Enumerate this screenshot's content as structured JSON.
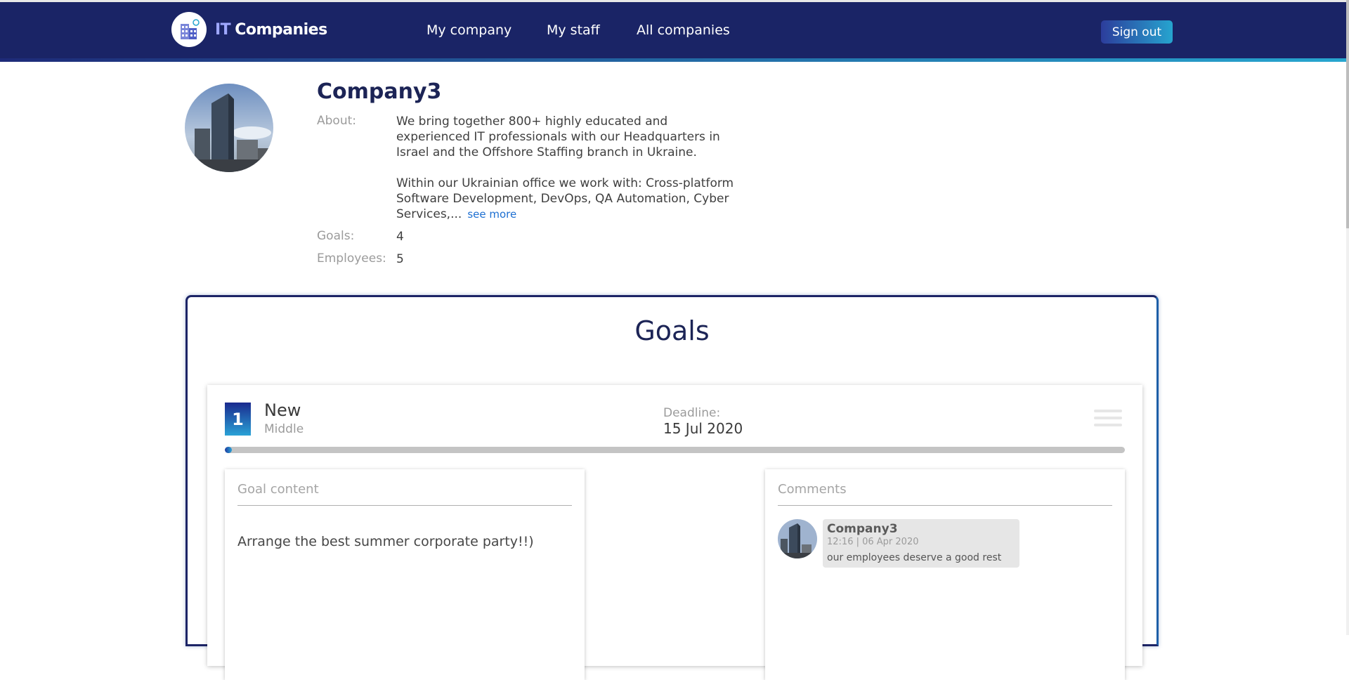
{
  "header": {
    "brand_prefix": "IT",
    "brand_name": "Companies",
    "nav": [
      "My company",
      "My staff",
      "All companies"
    ],
    "sign_out": "Sign out"
  },
  "company": {
    "name": "Company3",
    "about_label": "About:",
    "about_p1": "We bring together 800+ highly educated and experienced IT professionals with our Headquarters in Israel and the Offshore Staffing branch in Ukraine.",
    "about_p2": "Within our Ukrainian office we work with: Cross-platform Software Development, DevOps, QA Automation, Cyber Services,...",
    "see_more": "see more",
    "goals_label": "Goals:",
    "goals_value": "4",
    "employees_label": "Employees:",
    "employees_value": "5"
  },
  "goals": {
    "title": "Goals",
    "items": [
      {
        "number": "1",
        "status": "New",
        "priority": "Middle",
        "deadline_label": "Deadline:",
        "deadline": "15 Jul 2020",
        "progress": 0.008,
        "content_title": "Goal content",
        "content": "Arrange the best summer corporate party!!)",
        "comments_title": "Comments",
        "comments": [
          {
            "author": "Company3",
            "time": "12:16 | 06 Apr 2020",
            "text": "our employees deserve a good rest"
          }
        ]
      }
    ]
  },
  "colors": {
    "navbar": "#1a2466",
    "accent_start": "#1e2a78",
    "accent_end": "#27a6cf",
    "title": "#1c2456",
    "link": "#1d6fd1"
  }
}
